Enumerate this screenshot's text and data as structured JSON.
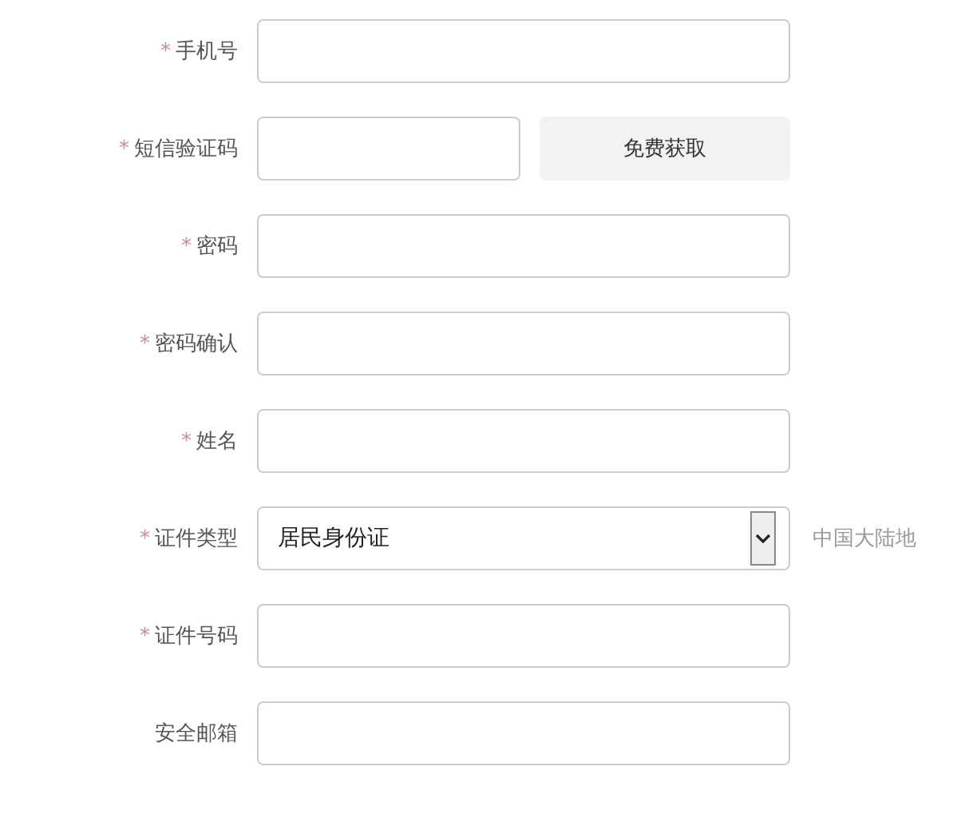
{
  "fields": [
    {
      "kind": "text",
      "label": "手机号",
      "required_mark": "*"
    },
    {
      "kind": "sms",
      "label": "短信验证码",
      "required_mark": "*",
      "button": "免费获取"
    },
    {
      "kind": "text",
      "label": "密码",
      "required_mark": "*"
    },
    {
      "kind": "text",
      "label": "密码确认",
      "required_mark": "*"
    },
    {
      "kind": "text",
      "label": "姓名",
      "required_mark": "*"
    },
    {
      "kind": "select",
      "label": "证件类型",
      "required_mark": "*",
      "value": "居民身份证",
      "note": "中国大陆地"
    },
    {
      "kind": "text",
      "label": "证件号码",
      "required_mark": "*"
    },
    {
      "kind": "text",
      "label": "安全邮箱"
    }
  ]
}
